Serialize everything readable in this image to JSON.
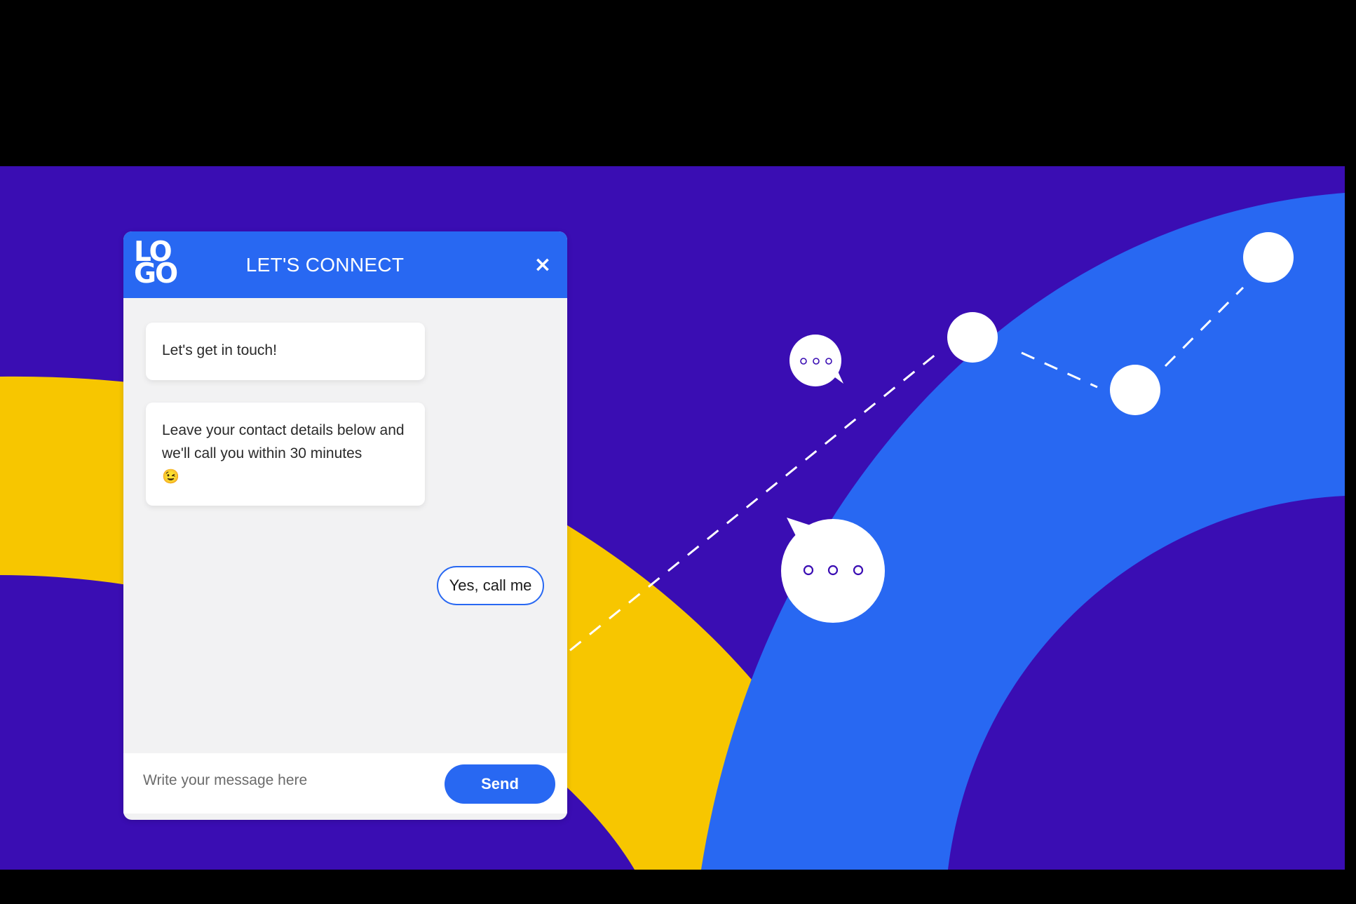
{
  "colors": {
    "background_purple": "#3a0db3",
    "accent_blue": "#2868f2",
    "accent_yellow": "#f7c600",
    "white": "#ffffff"
  },
  "chat": {
    "logo_line1": "LO",
    "logo_line2": "GO",
    "title": "LET'S CONNECT",
    "close_symbol": "×",
    "messages": [
      {
        "text": "Let's get in touch!"
      },
      {
        "text": "Leave your contact details below and we'll call you within 30 minutes",
        "emoji": "😉"
      }
    ],
    "quick_reply": "Yes, call me",
    "input_placeholder": "Write your message here",
    "send_label": "Send"
  },
  "decor": {
    "bubble_small_dots": "o o o",
    "bubble_large_dots": "o o o"
  }
}
